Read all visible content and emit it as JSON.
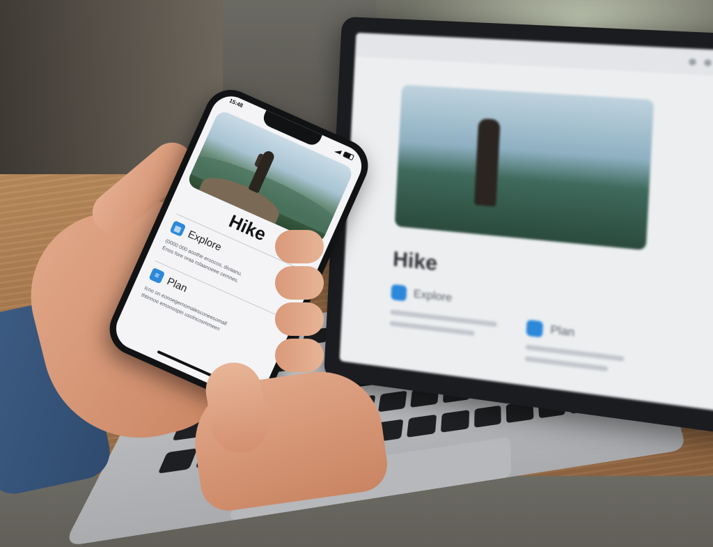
{
  "phone": {
    "time": "15:48",
    "app_title": "Hike",
    "sections": [
      {
        "icon": "map-icon",
        "label": "Explore",
        "lines": [
          "(0000 000 aoothe eroocos, divaanu.",
          "Enos fore oraa rolaanoeee cemnes."
        ]
      },
      {
        "icon": "document-icon",
        "label": "Plan",
        "lines": [
          "Icno on eonoegernomalesconeesomall",
          "thtinnoo emonoopin usolncosmmeen"
        ]
      }
    ]
  },
  "laptop": {
    "title": "Hike",
    "items": [
      {
        "label": "Explore"
      },
      {
        "label": "Plan"
      }
    ]
  },
  "colors": {
    "accent": "#2c88d9",
    "text": "#121316"
  }
}
